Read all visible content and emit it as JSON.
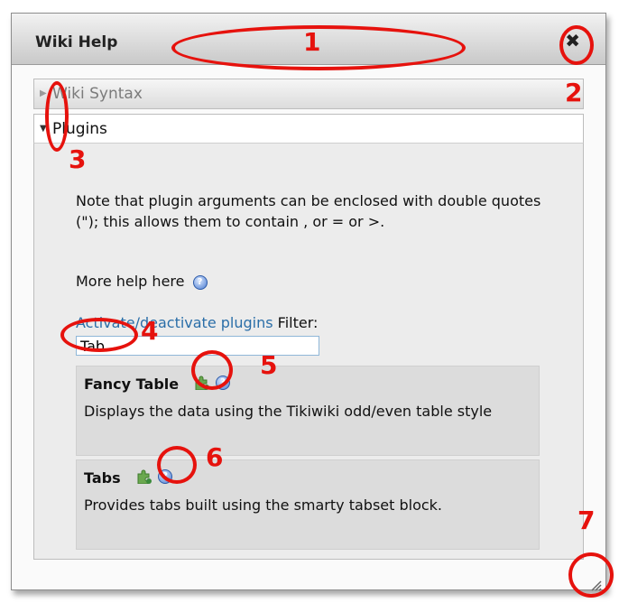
{
  "dialog": {
    "title": "Wiki Help",
    "close_symbol": "✖"
  },
  "accordion": {
    "collapsed": {
      "label": "Wiki Syntax",
      "arrow": "▶"
    },
    "open": {
      "label": "Plugins",
      "arrow": "▼"
    }
  },
  "plugins_panel": {
    "note": "Note that plugin arguments can be enclosed with double quotes (\"); this allows them to contain , or = or >.",
    "more_help": "More help here",
    "activate_link": "Activate/deactivate plugins",
    "filter_label": "Filter:",
    "filter_value": "Tab"
  },
  "plugins": [
    {
      "name": "Fancy Table",
      "description": "Displays the data using the Tikiwiki odd/even table style"
    },
    {
      "name": "Tabs",
      "description": "Provides tabs built using the smarty tabset block."
    }
  ],
  "annotations": [
    "1",
    "2",
    "3",
    "4",
    "5",
    "6",
    "7"
  ],
  "icons": {
    "help": "help-icon",
    "plugin": "puzzle-icon",
    "close": "close-icon",
    "resize": "resize-grip-icon"
  },
  "colors": {
    "annotation": "#e6120d",
    "link": "#2a6ea8",
    "panel_bg": "#ececec",
    "card_bg": "#dcdcdc"
  }
}
